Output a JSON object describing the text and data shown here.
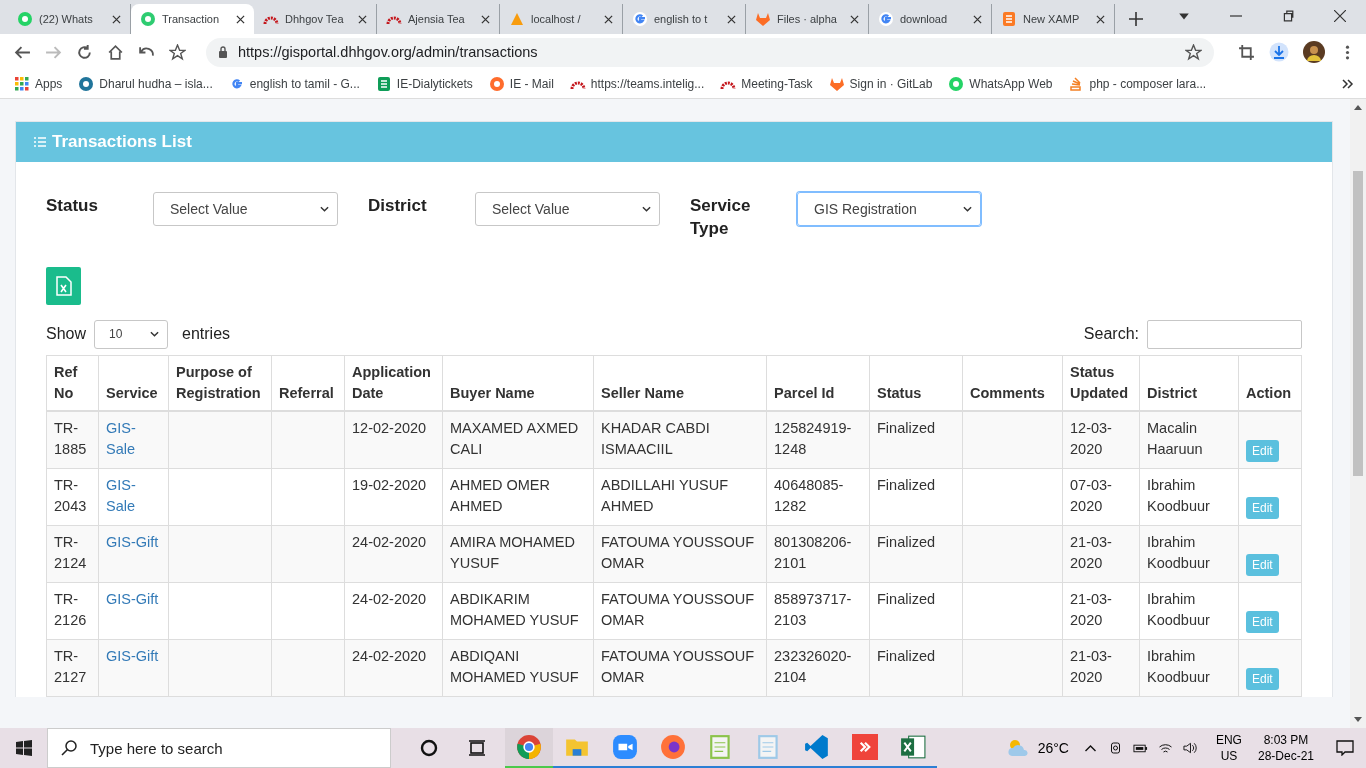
{
  "browser": {
    "tabs": [
      {
        "kind": "whatsapp",
        "title": "(22) Whats",
        "selected": false
      },
      {
        "kind": "greenapp",
        "title": "Transaction",
        "selected": true
      },
      {
        "kind": "redarc",
        "title": "Dhhgov Tea",
        "selected": false
      },
      {
        "kind": "redarc",
        "title": "Ajensia Tea",
        "selected": false
      },
      {
        "kind": "pma",
        "title": "localhost /",
        "selected": false
      },
      {
        "kind": "google",
        "title": "english to t",
        "selected": false
      },
      {
        "kind": "gitlab",
        "title": "Files · alpha",
        "selected": false
      },
      {
        "kind": "google",
        "title": "download",
        "selected": false
      },
      {
        "kind": "xampp",
        "title": "New XAMP",
        "selected": false
      }
    ],
    "url": "https://gisportal.dhhgov.org/admin/transactions",
    "bookmarks": [
      {
        "kind": "apps",
        "label": "Apps"
      },
      {
        "kind": "wordpress",
        "label": "Dharul hudha – isla..."
      },
      {
        "kind": "google",
        "label": "english to tamil - G..."
      },
      {
        "kind": "sheets",
        "label": "IE-Dialytickets"
      },
      {
        "kind": "cpanel",
        "label": "IE - Mail"
      },
      {
        "kind": "redarc",
        "label": "https://teams.intelig..."
      },
      {
        "kind": "redarc",
        "label": "Meeting-Task"
      },
      {
        "kind": "gitlab",
        "label": "Sign in · GitLab"
      },
      {
        "kind": "whatsapp",
        "label": "WhatsApp Web"
      },
      {
        "kind": "stack",
        "label": "php - composer lara..."
      }
    ]
  },
  "page": {
    "title": "Transactions List",
    "filters": [
      {
        "label": "Status",
        "value": "Select Value",
        "focused": false
      },
      {
        "label": "District",
        "value": "Select Value",
        "focused": false
      },
      {
        "label": "Service Type",
        "value": "GIS Registration",
        "focused": true
      }
    ],
    "length": {
      "prefix": "Show",
      "value": "10",
      "suffix": "entries"
    },
    "search_label": "Search:",
    "table": {
      "columns": [
        "Ref No",
        "Service",
        "Purpose of Registration",
        "Referral",
        "Application Date",
        "Buyer Name",
        "Seller Name",
        "Parcel Id",
        "Status",
        "Comments",
        "Status Updated",
        "District",
        "Action"
      ],
      "rows": [
        {
          "ref": "TR-1885",
          "service": "GIS-Sale",
          "date": "12-02-2020",
          "buyer": "MAXAMED AXMED CALI",
          "seller": "KHADAR CABDI ISMAACIIL",
          "parcel": "125824919-1248",
          "status": "Finalized",
          "updated": "12-03-2020",
          "district": "Macalin Haaruun",
          "action": "Edit"
        },
        {
          "ref": "TR-2043",
          "service": "GIS-Sale",
          "date": "19-02-2020",
          "buyer": "AHMED OMER AHMED",
          "seller": "ABDILLAHI YUSUF AHMED",
          "parcel": "40648085-1282",
          "status": "Finalized",
          "updated": "07-03-2020",
          "district": "Ibrahim Koodbuur",
          "action": "Edit"
        },
        {
          "ref": "TR-2124",
          "service": "GIS-Gift",
          "date": "24-02-2020",
          "buyer": "AMIRA MOHAMED YUSUF",
          "seller": "FATOUMA YOUSSOUF OMAR",
          "parcel": "801308206-2101",
          "status": "Finalized",
          "updated": "21-03-2020",
          "district": "Ibrahim Koodbuur",
          "action": "Edit"
        },
        {
          "ref": "TR-2126",
          "service": "GIS-Gift",
          "date": "24-02-2020",
          "buyer": "ABDIKARIM MOHAMED YUSUF",
          "seller": "FATOUMA YOUSSOUF OMAR",
          "parcel": "858973717-2103",
          "status": "Finalized",
          "updated": "21-03-2020",
          "district": "Ibrahim Koodbuur",
          "action": "Edit"
        },
        {
          "ref": "TR-2127",
          "service": "GIS-Gift",
          "date": "24-02-2020",
          "buyer": "ABDIQANI MOHAMED YUSUF",
          "seller": "FATOUMA YOUSSOUF OMAR",
          "parcel": "232326020-2104",
          "status": "Finalized",
          "updated": "21-03-2020",
          "district": "Ibrahim Koodbuur",
          "action": "Edit"
        }
      ]
    }
  },
  "taskbar": {
    "search_placeholder": "Type here to search",
    "apps": [
      {
        "kind": "chrome",
        "active": true
      },
      {
        "kind": "folder",
        "active": false
      },
      {
        "kind": "zoom",
        "active": false
      },
      {
        "kind": "firefox",
        "active": false
      },
      {
        "kind": "notepadpp",
        "active": false
      },
      {
        "kind": "notepad",
        "active": false
      },
      {
        "kind": "vscode",
        "active": false
      },
      {
        "kind": "anydesk",
        "active": false
      },
      {
        "kind": "excel",
        "active": false
      }
    ],
    "weather": "26°C",
    "lang": "ENG",
    "region": "US",
    "time": "8:03 PM",
    "date": "28-Dec-21"
  }
}
